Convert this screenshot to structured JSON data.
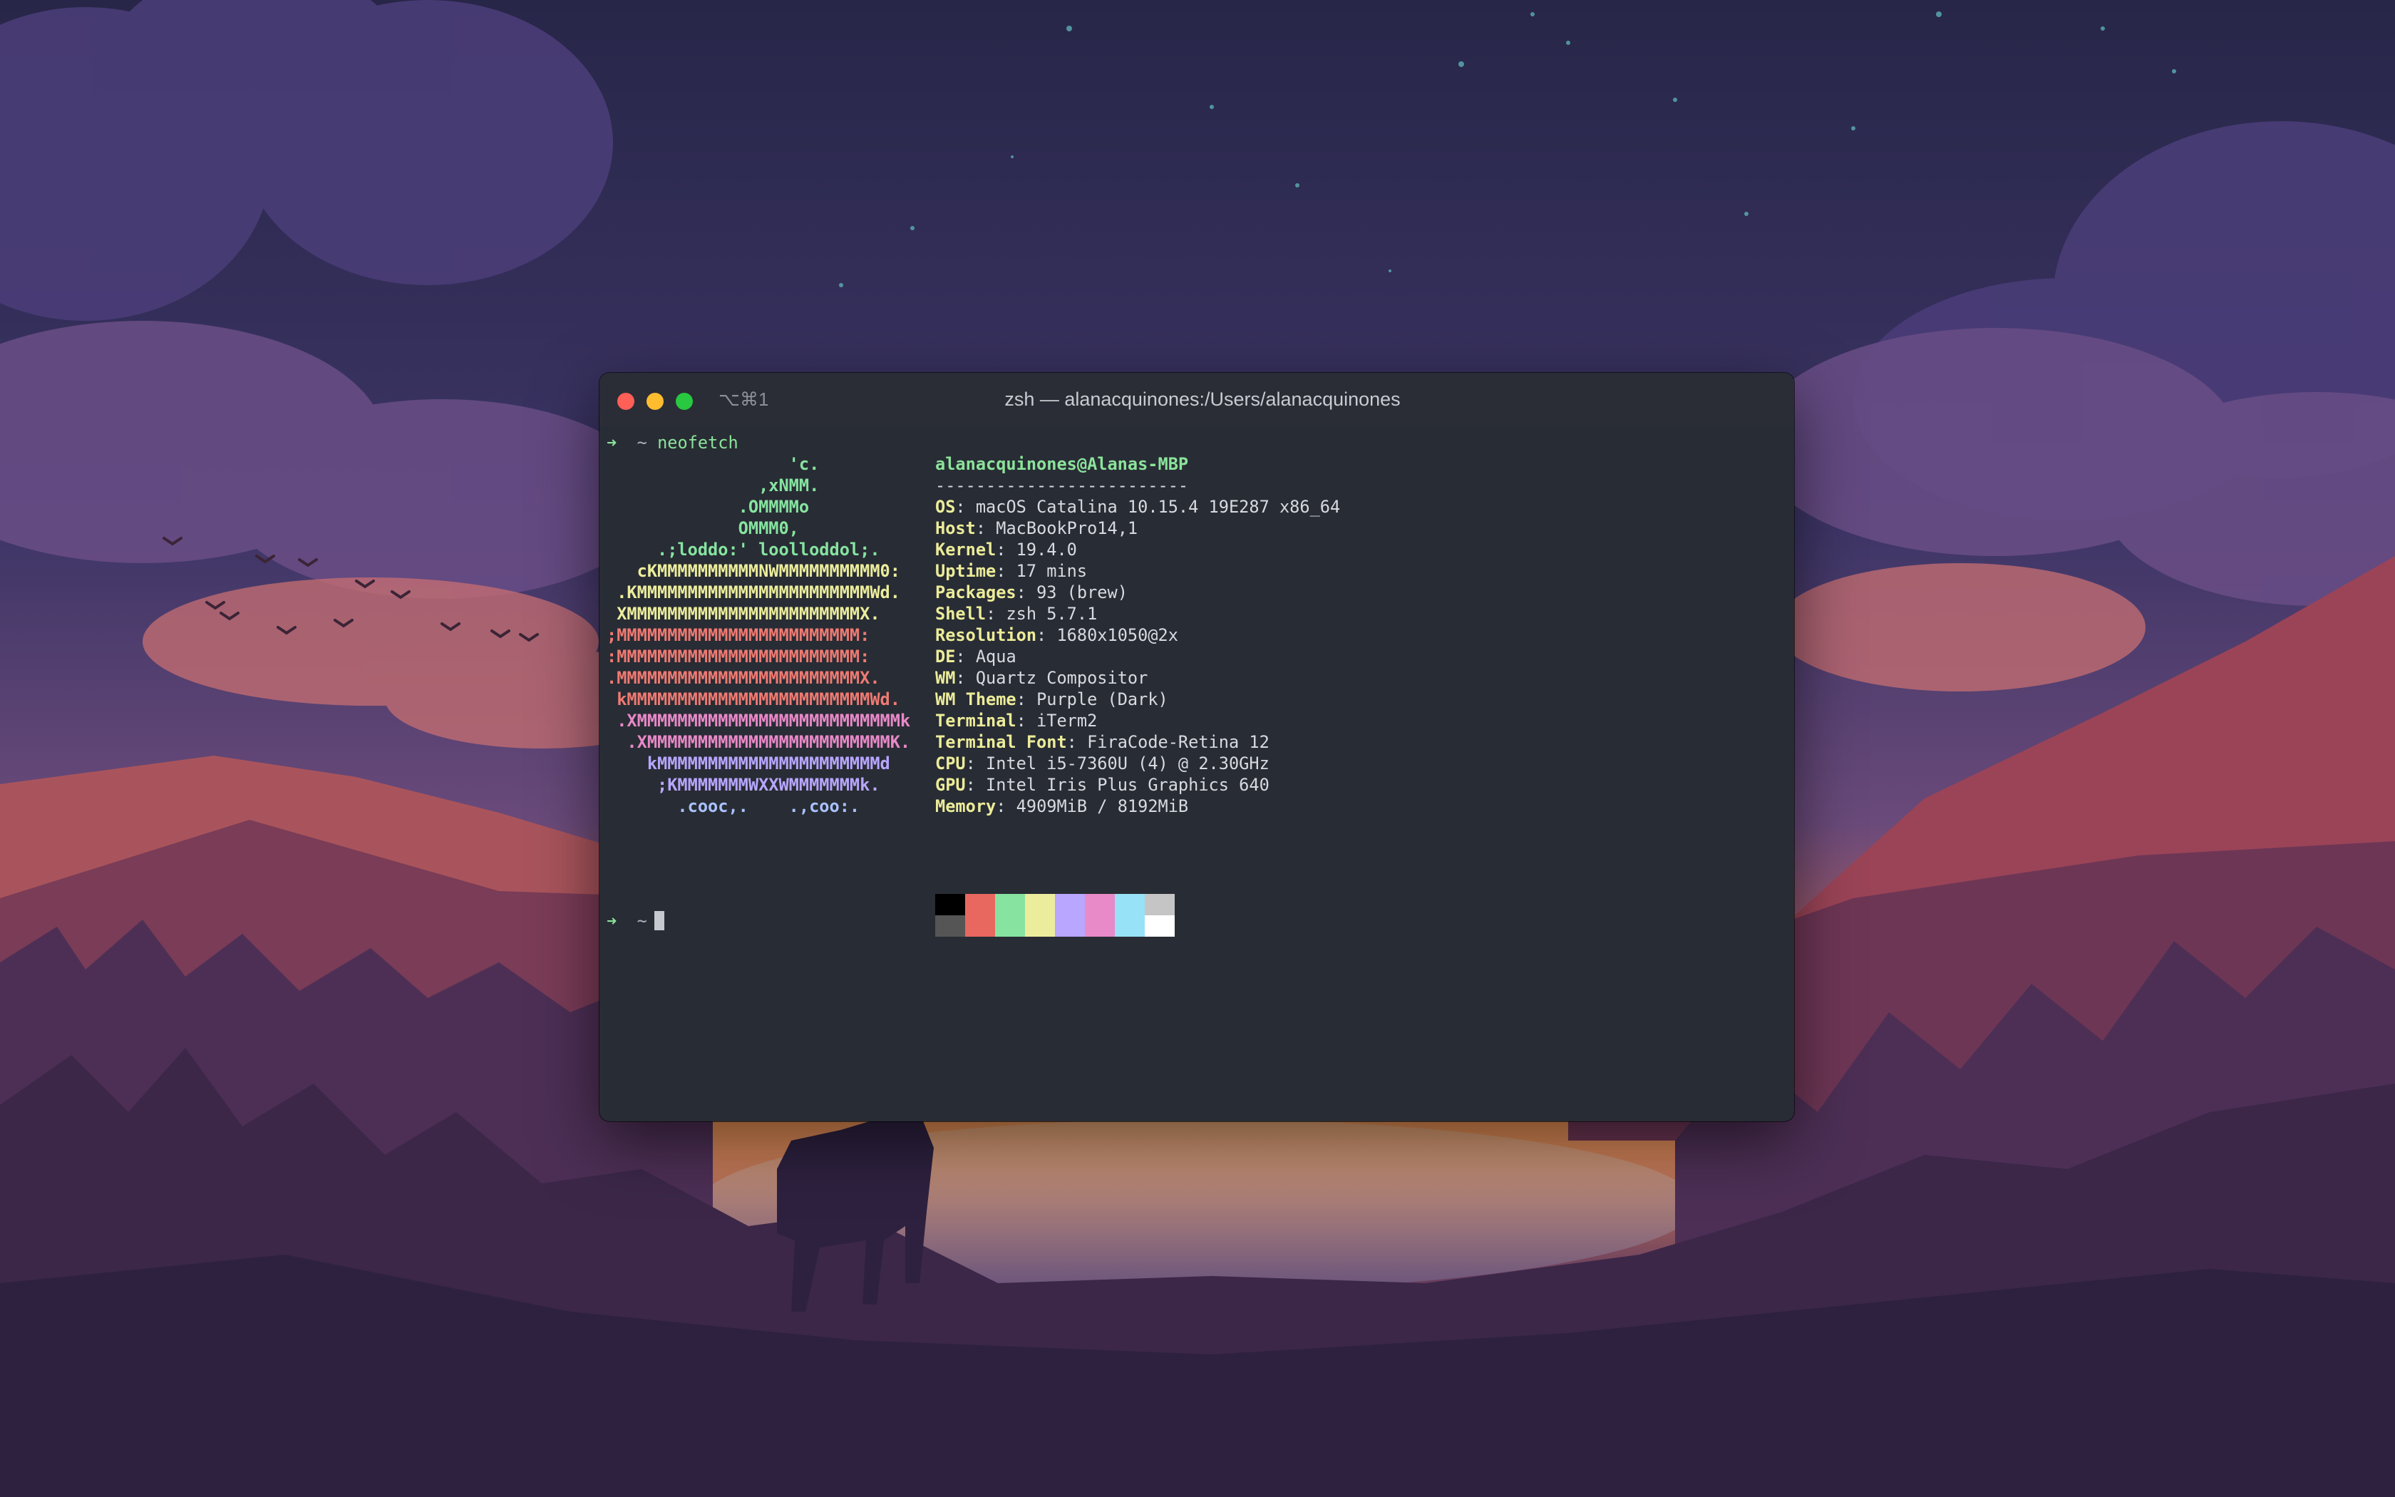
{
  "window": {
    "tab_shortcut": "⌥⌘1",
    "title": "zsh — alanacquinones:/Users/alanacquinones"
  },
  "prompt": {
    "arrow": "➜",
    "cwd": "~",
    "command": "neofetch"
  },
  "neofetch": {
    "logo": [
      {
        "text": "                  'c.",
        "color": "green"
      },
      {
        "text": "               ,xNMM.",
        "color": "green"
      },
      {
        "text": "             .OMMMMo",
        "color": "green"
      },
      {
        "text": "             OMMM0,",
        "color": "green"
      },
      {
        "text": "     .;loddo:' loolloddol;.",
        "color": "green"
      },
      {
        "text": "   cKMMMMMMMMMMNWMMMMMMMMMM0:",
        "color": "yellow"
      },
      {
        "text": " .KMMMMMMMMMMMMMMMMMMMMMMMWd.",
        "color": "yellow"
      },
      {
        "text": " XMMMMMMMMMMMMMMMMMMMMMMMX.",
        "color": "yellow"
      },
      {
        "text": ";MMMMMMMMMMMMMMMMMMMMMMMM:",
        "color": "red"
      },
      {
        "text": ":MMMMMMMMMMMMMMMMMMMMMMMM:",
        "color": "red"
      },
      {
        "text": ".MMMMMMMMMMMMMMMMMMMMMMMMX.",
        "color": "red"
      },
      {
        "text": " kMMMMMMMMMMMMMMMMMMMMMMMMWd.",
        "color": "red"
      },
      {
        "text": " .XMMMMMMMMMMMMMMMMMMMMMMMMMMk",
        "color": "pink"
      },
      {
        "text": "  .XMMMMMMMMMMMMMMMMMMMMMMMMK.",
        "color": "pink"
      },
      {
        "text": "    kMMMMMMMMMMMMMMMMMMMMMMd",
        "color": "purple"
      },
      {
        "text": "     ;KMMMMMMMWXXWMMMMMMMk.",
        "color": "purple"
      },
      {
        "text": "       .cooc,.    .,coo:.",
        "color": "blue"
      }
    ],
    "user_host": "alanacquinones@Alanas-MBP",
    "separator": "-------------------------",
    "info": [
      {
        "key": "OS",
        "value": "macOS Catalina 10.15.4 19E287 x86_64"
      },
      {
        "key": "Host",
        "value": "MacBookPro14,1"
      },
      {
        "key": "Kernel",
        "value": "19.4.0"
      },
      {
        "key": "Uptime",
        "value": "17 mins"
      },
      {
        "key": "Packages",
        "value": "93 (brew)"
      },
      {
        "key": "Shell",
        "value": "zsh 5.7.1"
      },
      {
        "key": "Resolution",
        "value": "1680x1050@2x"
      },
      {
        "key": "DE",
        "value": "Aqua"
      },
      {
        "key": "WM",
        "value": "Quartz Compositor"
      },
      {
        "key": "WM Theme",
        "value": "Purple (Dark)"
      },
      {
        "key": "Terminal",
        "value": "iTerm2"
      },
      {
        "key": "Terminal Font",
        "value": "FiraCode-Retina 12"
      },
      {
        "key": "CPU",
        "value": "Intel i5-7360U (4) @ 2.30GHz"
      },
      {
        "key": "GPU",
        "value": "Intel Iris Plus Graphics 640"
      },
      {
        "key": "Memory",
        "value": "4909MiB / 8192MiB"
      }
    ],
    "palette_top": [
      "#000000",
      "#e8685f",
      "#86e4a0",
      "#eced9c",
      "#b8a6ff",
      "#e889c8",
      "#97e2f7",
      "#c5c5c5"
    ],
    "palette_bottom": [
      "#555555",
      "#e8685f",
      "#86e4a0",
      "#eced9c",
      "#b8a6ff",
      "#e889c8",
      "#97e2f7",
      "#ffffff"
    ]
  },
  "prompt2": {
    "arrow": "➜",
    "cwd": "~"
  },
  "colors": {
    "green": "#86e4a0",
    "yellow": "#eced9c",
    "red": "#ef7a72",
    "pink": "#e889c8",
    "purple": "#b8a6ff",
    "blue": "#a9c2ff"
  }
}
